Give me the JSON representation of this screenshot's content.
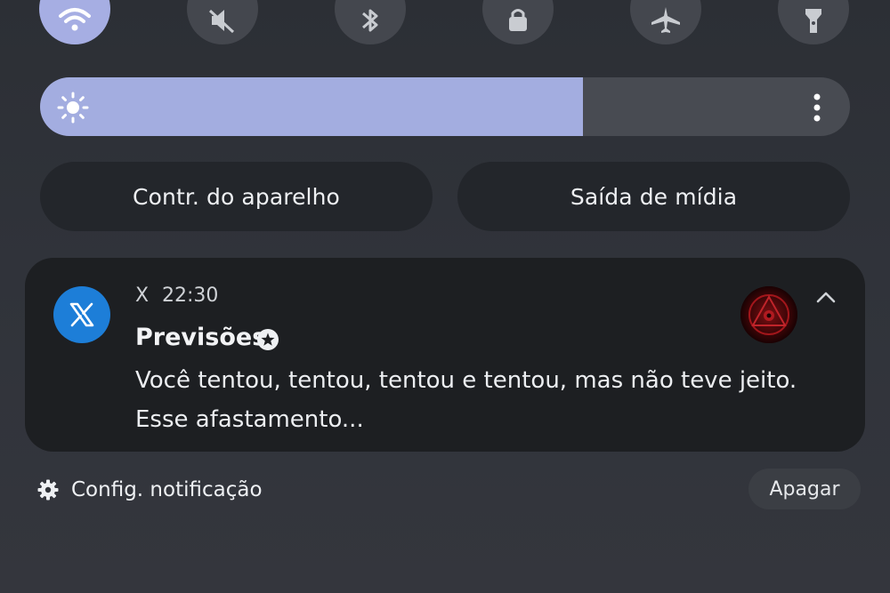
{
  "quick_settings": {
    "toggles": [
      {
        "icon": "wifi-icon",
        "active": true
      },
      {
        "icon": "mute-icon",
        "active": false
      },
      {
        "icon": "bluetooth-icon",
        "active": false
      },
      {
        "icon": "screen-lock-icon",
        "active": false
      },
      {
        "icon": "airplane-icon",
        "active": false
      },
      {
        "icon": "flashlight-icon",
        "active": false
      }
    ],
    "brightness_level": 0.67,
    "accent_color": "#a6aee3"
  },
  "shortcuts": {
    "device_control_label": "Contr. do aparelho",
    "media_output_label": "Saída de mídia"
  },
  "notification": {
    "app_icon": "x-logo-icon",
    "app_name": "X",
    "time": "22:30",
    "title": "Previsões",
    "body": "Você tentou, tentou, tentou e tentou, mas não teve jeito. Esse afastamento...",
    "app_icon_color": "#1d7ed8"
  },
  "footer": {
    "settings_label": "Config. notificação",
    "clear_label": "Apagar"
  }
}
